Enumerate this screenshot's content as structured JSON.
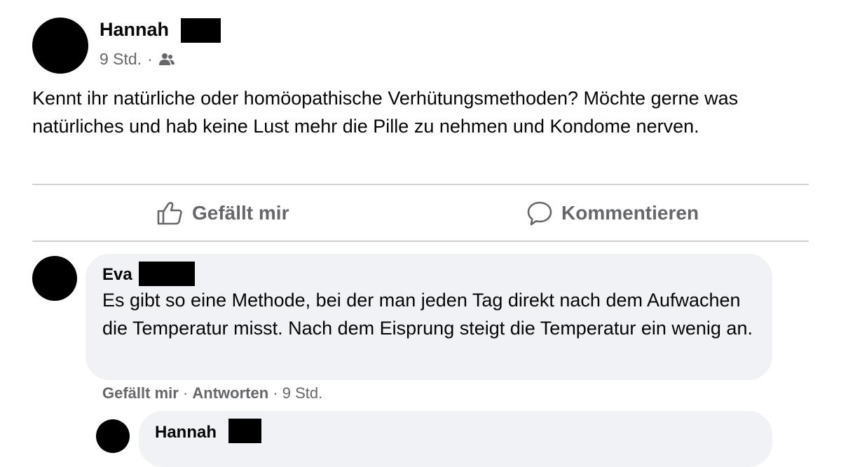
{
  "post": {
    "author": "Hannah",
    "time": "9 Std.",
    "separator": "·",
    "audience_icon": "friends-icon",
    "text": "Kennt ihr natürliche oder homöopathische Verhütungsmethoden? Möchte gerne was natürliches und hab keine Lust mehr die Pille zu nehmen und Kondome nerven."
  },
  "actions": {
    "like_label": "Gefällt mir",
    "comment_label": "Kommentieren"
  },
  "comments": [
    {
      "author": "Eva",
      "text": "Es gibt so eine Methode, bei der man jeden Tag direkt nach dem Aufwachen die Temperatur misst. Nach dem Eisprung steigt die Temperatur ein wenig an.",
      "like_label": "Gefällt mir",
      "reply_label": "Antworten",
      "time": "9 Std.",
      "separator": "·"
    },
    {
      "author": "Hannah"
    }
  ],
  "colors": {
    "secondary_text": "#65676b",
    "bubble": "#f0f2f5",
    "divider": "#ced0d4",
    "redaction": "#000000"
  }
}
